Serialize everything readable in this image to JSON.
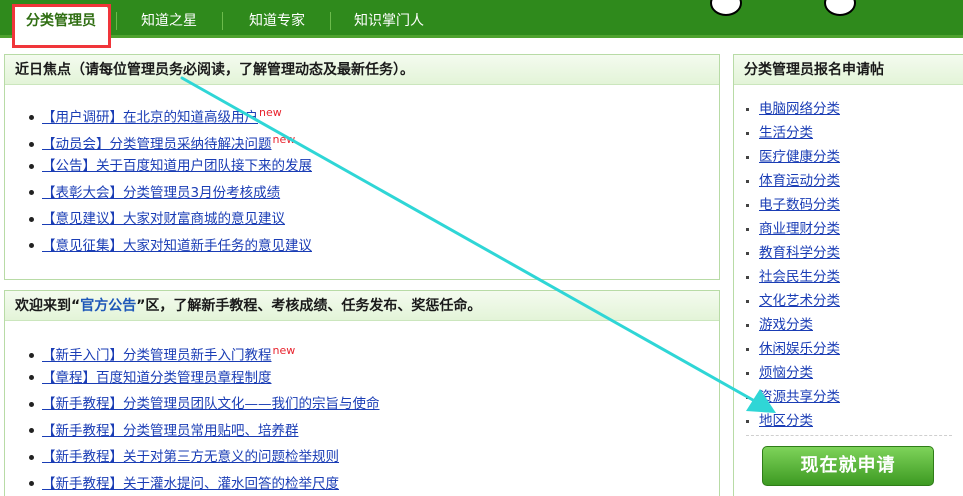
{
  "nav": {
    "tabs": [
      {
        "label": "分类管理员",
        "active": true
      },
      {
        "label": "知道之星",
        "active": false
      },
      {
        "label": "知道专家",
        "active": false
      },
      {
        "label": "知识掌门人",
        "active": false
      }
    ]
  },
  "focus": {
    "title": "近日焦点（请每位管理员务必阅读，了解管理动态及最新任务）。",
    "items": [
      {
        "text": "【用户调研】在北京的知道高级用户",
        "new": "new"
      },
      {
        "text": "【动员会】分类管理员采纳待解决问题",
        "new": "new"
      },
      {
        "text": "【公告】关于百度知道用户团队接下来的发展"
      },
      {
        "text": "【表彰大会】分类管理员3月份考核成绩"
      },
      {
        "text": "【意见建议】大家对财富商城的意见建议"
      },
      {
        "text": "【意见征集】大家对知道新手任务的意见建议"
      }
    ]
  },
  "welcome": {
    "title_prefix": "欢迎来到“",
    "title_keyword": "官方公告",
    "title_suffix": "”区，了解新手教程、考核成绩、任务发布、奖惩任命。",
    "items": [
      {
        "text": "【新手入门】分类管理员新手入门教程",
        "new": "new"
      },
      {
        "text": "【章程】百度知道分类管理员章程制度"
      },
      {
        "text": "【新手教程】分类管理员团队文化——我们的宗旨与使命"
      },
      {
        "text": "【新手教程】分类管理员常用贴吧、培养群"
      },
      {
        "text": "【新手教程】关于对第三方无意义的问题检举规则"
      },
      {
        "text": "【新手教程】关于灌水提问、灌水回答的检举尺度"
      }
    ]
  },
  "signup": {
    "title": "分类管理员报名申请帖",
    "categories": [
      "电脑网络分类",
      "生活分类",
      "医疗健康分类",
      "体育运动分类",
      "电子数码分类",
      "商业理财分类",
      "教育科学分类",
      "社会民生分类",
      "文化艺术分类",
      "游戏分类",
      "休闲娱乐分类",
      "烦恼分类",
      "资源共享分类",
      "地区分类"
    ],
    "apply_label": "现在就申请"
  },
  "colors": {
    "nav_green": "#2f8a1c",
    "link_blue": "#1a3db5",
    "highlight_red": "#f0353a",
    "arrow_cyan": "#2fd6d6",
    "button_green": "#4caf2a"
  },
  "annotations": {
    "highlight": "red-box-around-active-tab",
    "arrow": "cyan-arrow-to-地区分类"
  }
}
